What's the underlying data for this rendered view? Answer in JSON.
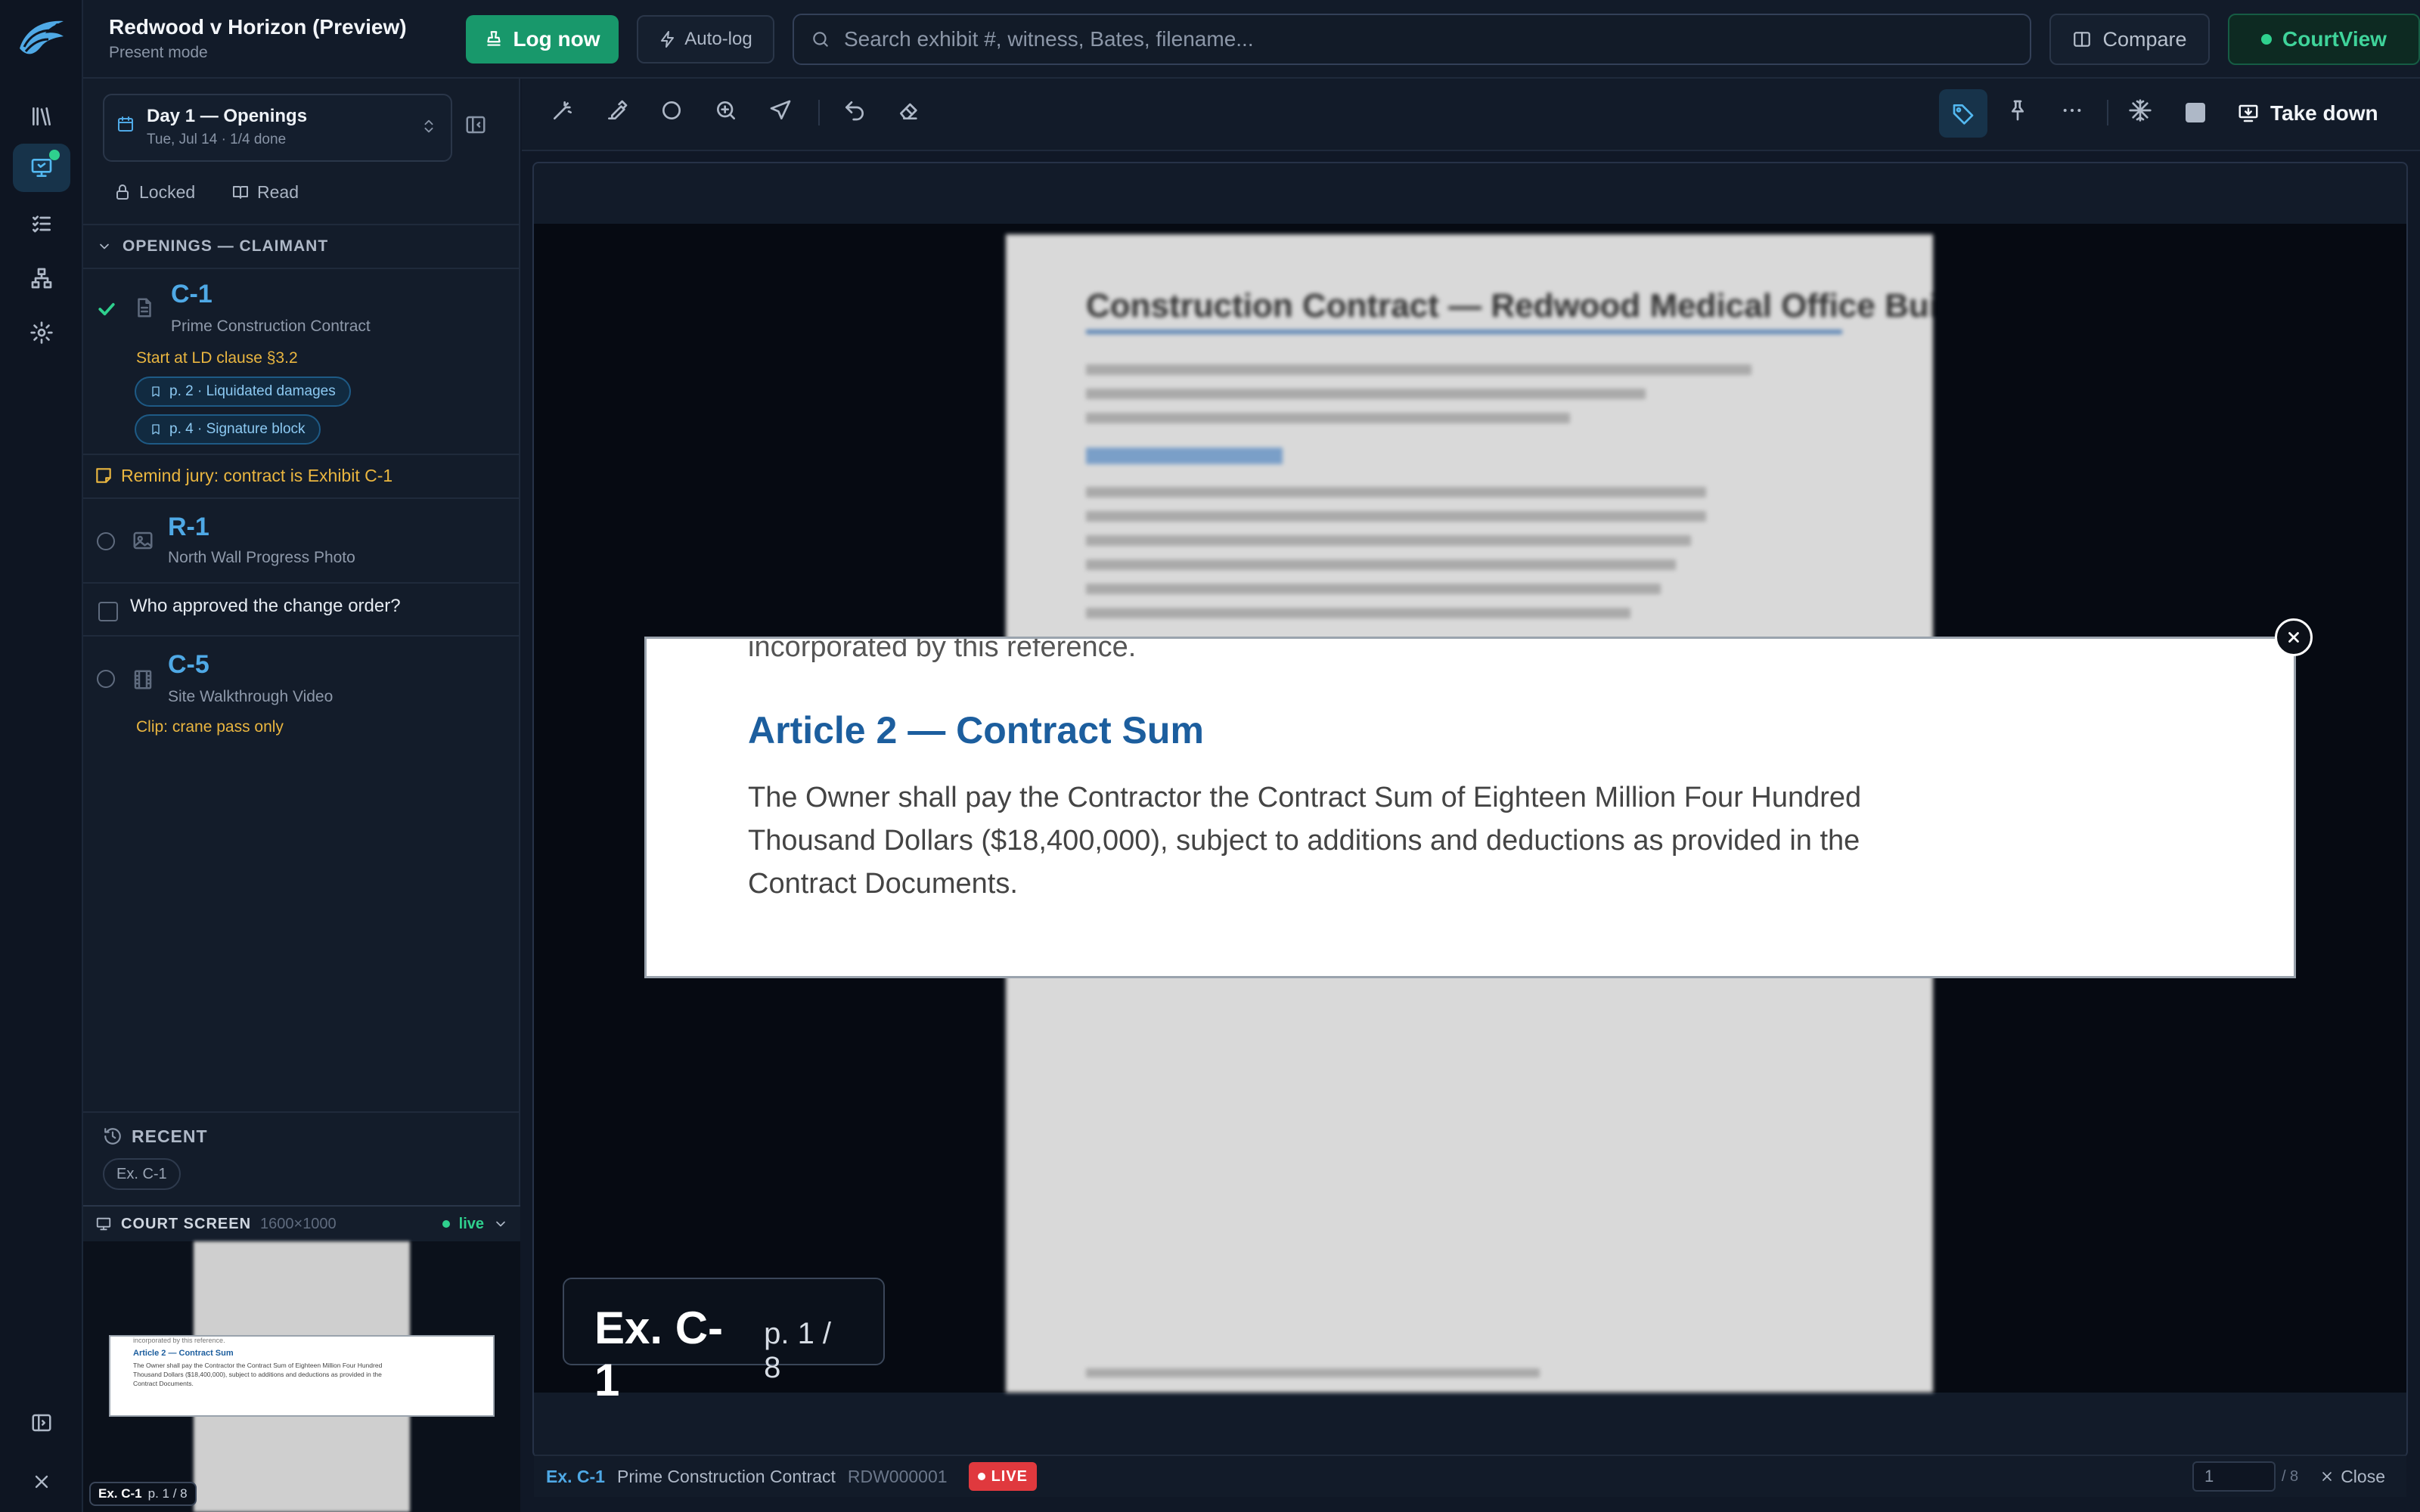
{
  "app": {
    "case_title": "Redwood v Horizon (Preview)",
    "mode": "Present mode",
    "log_now": "Log now",
    "auto_log": "Auto-log",
    "search_placeholder": "Search exhibit #, witness, Bates, filename...",
    "compare": "Compare",
    "courtview": "CourtView"
  },
  "rail": {
    "icons": [
      "library-icon",
      "presentation-icon",
      "checklist-icon",
      "hierarchy-icon",
      "gear-icon"
    ],
    "active": "presentation-icon"
  },
  "sidebar": {
    "day_title": "Day 1 — Openings",
    "day_sub": "Tue, Jul 14 · 1/4 done",
    "locked": "Locked",
    "read": "Read",
    "section": "OPENINGS — CLAIMANT",
    "items": [
      {
        "id": "C-1",
        "name": "Prime Construction Contract",
        "note": "Start at LD clause §3.2",
        "bookmarks": [
          "p. 2 · Liquidated damages",
          "p. 4 · Signature block"
        ],
        "done": true
      },
      {
        "reminder": "Remind jury: contract is Exhibit C-1"
      },
      {
        "id": "R-1",
        "name": "North Wall Progress Photo"
      },
      {
        "task": "Who approved the change order?"
      },
      {
        "id": "C-5",
        "name": "Site Walkthrough Video",
        "note": "Clip: crane pass only"
      }
    ],
    "recent_label": "RECENT",
    "recent_chip": "Ex. C-1",
    "court_screen_label": "COURT SCREEN",
    "court_screen_res": "1600×1000",
    "live_label": "live",
    "mini_label": "Ex. C-1",
    "mini_page": "p. 1 / 8"
  },
  "toolbar": {
    "take_down": "Take down"
  },
  "document": {
    "title": "Construction Contract — Redwood Medical Office Building",
    "prev_line": "incorporated by this reference.",
    "heading": "Article 2 — Contract Sum",
    "body": "The Owner shall pay the Contractor the Contract Sum of Eighteen Million Four Hundred Thousand Dollars ($18,400,000), subject to additions and deductions as provided in the Contract Documents.",
    "label_ex": "Ex. C-1",
    "label_page": "p. 1 / 8"
  },
  "status": {
    "ex": "Ex. C-1",
    "name": "Prime Construction Contract",
    "bates": "RDW000001",
    "live": "LIVE",
    "page_value": "1",
    "page_total": "/ 8",
    "close": "Close"
  },
  "colors": {
    "accent": "#4fa9e6",
    "success": "#18986b",
    "warning": "#eab640",
    "live": "#e0393e"
  }
}
